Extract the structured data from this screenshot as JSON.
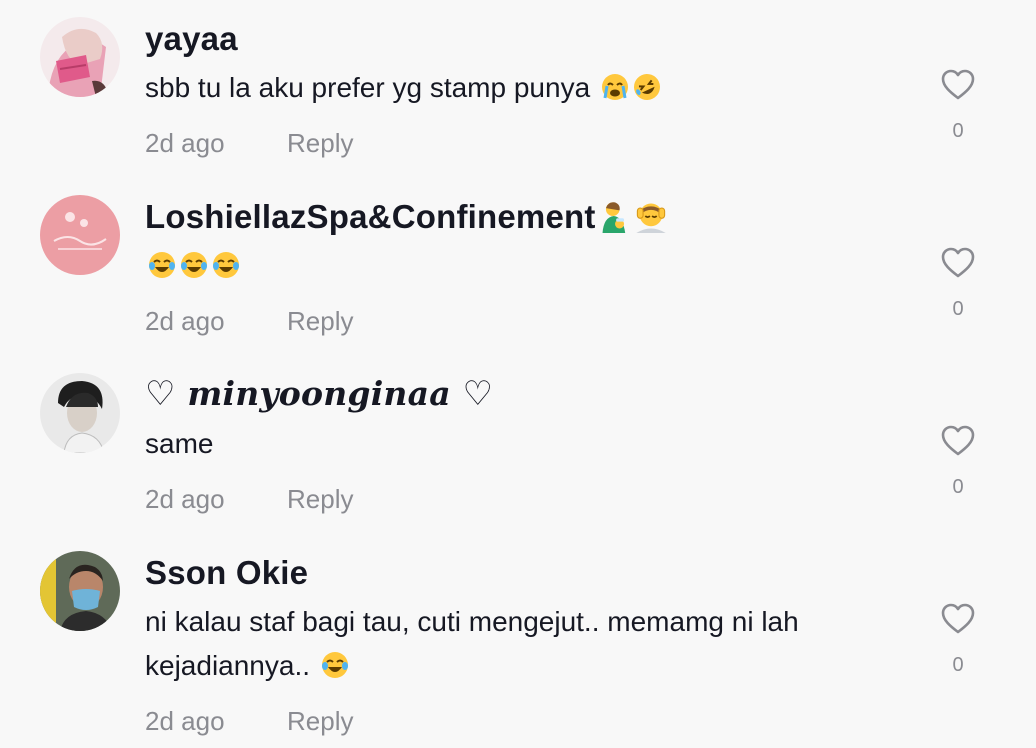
{
  "comments": [
    {
      "username": "yayaa",
      "text": "sbb tu la aku prefer yg stamp punya",
      "emojis": [
        "loudly-crying-face",
        "rolling-on-floor-laughing"
      ],
      "time": "2d ago",
      "reply": "Reply",
      "likes": "0"
    },
    {
      "username": "LoshiellazSpa&Confinement",
      "username_emojis": [
        "woman-feeding-baby",
        "person-getting-massage"
      ],
      "text": "",
      "emojis": [
        "face-with-tears-of-joy",
        "face-with-tears-of-joy",
        "face-with-tears-of-joy"
      ],
      "time": "2d ago",
      "reply": "Reply",
      "likes": "0"
    },
    {
      "username_prefix": "♡",
      "username": "minyoonginaa",
      "username_suffix": "♡",
      "text": "same",
      "time": "2d ago",
      "reply": "Reply",
      "likes": "0"
    },
    {
      "username": "Sson Okie",
      "text": "ni kalau staf bagi tau, cuti mengejut.. memamg ni lah\nkejadiannya..",
      "emojis": [
        "face-with-tears-of-joy"
      ],
      "time": "2d ago",
      "reply": "Reply",
      "likes": "0"
    }
  ],
  "colors": {
    "background": "#f8f8f8",
    "primary_text": "#161823",
    "secondary_text": "#8a8b91"
  }
}
